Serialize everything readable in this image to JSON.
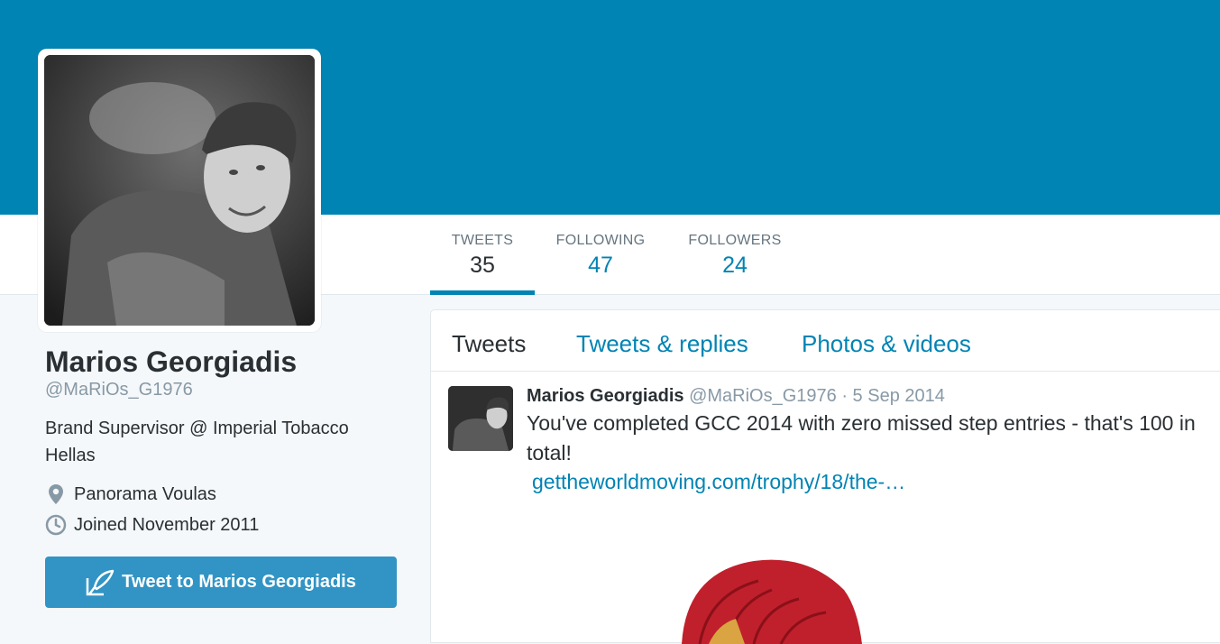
{
  "profile": {
    "name": "Marios Georgiadis",
    "handle": "@MaRiOs_G1976",
    "bio": "Brand Supervisor @ Imperial Tobacco Hellas",
    "location": "Panorama Voulas",
    "joined": "Joined November 2011",
    "tweet_to_label": "Tweet to Marios Georgiadis"
  },
  "stats": [
    {
      "label": "TWEETS",
      "value": "35"
    },
    {
      "label": "FOLLOWING",
      "value": "47"
    },
    {
      "label": "FOLLOWERS",
      "value": "24"
    }
  ],
  "timeline": {
    "tabs": [
      {
        "label": "Tweets"
      },
      {
        "label": "Tweets & replies"
      },
      {
        "label": "Photos & videos"
      }
    ],
    "tweet": {
      "name": "Marios Georgiadis",
      "handle": "@MaRiOs_G1976",
      "separator": " · ",
      "date": "5 Sep 2014",
      "text": "You've completed GCC 2014 with zero missed step entries - that's 100 in total!",
      "link": "gettheworldmoving.com/trophy/18/the-…"
    }
  },
  "colors": {
    "brand": "#0084b4",
    "button": "#3194c4",
    "muted": "#8899a6"
  },
  "icons": {
    "location": "location-pin-icon",
    "joined": "clock-icon",
    "tweet_to": "compose-quill-icon"
  }
}
